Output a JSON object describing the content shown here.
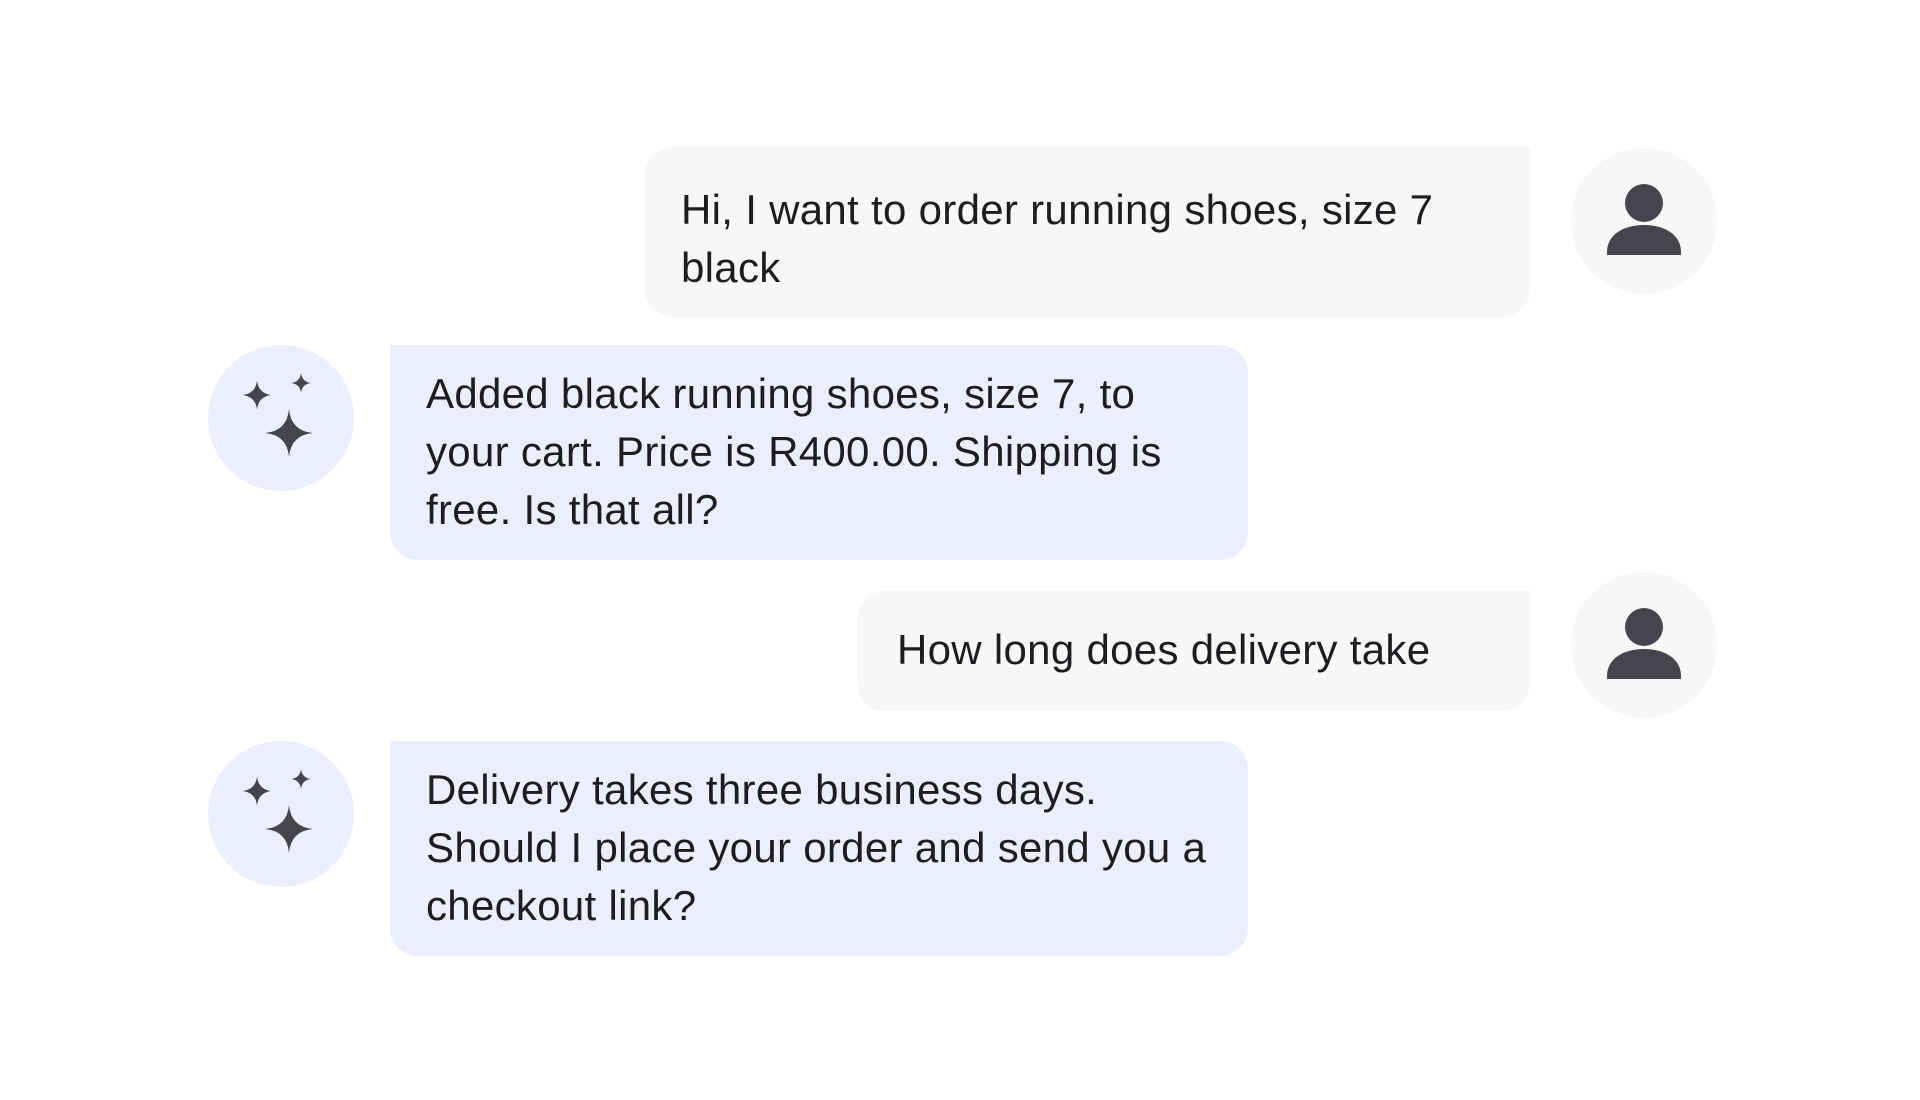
{
  "messages": [
    {
      "role": "user",
      "text": "Hi, I want to order running shoes, size 7 black",
      "avatar_icon": "person-icon"
    },
    {
      "role": "assistant",
      "text": "Added black running shoes, size 7, to your cart. Price is R400.00. Shipping is free. Is that all?",
      "avatar_icon": "sparkles-icon"
    },
    {
      "role": "user",
      "text": "How long does delivery take",
      "avatar_icon": "person-icon"
    },
    {
      "role": "assistant",
      "text": "Delivery takes three business days. Should I place your order and send you a checkout link?",
      "avatar_icon": "sparkles-icon"
    }
  ],
  "colors": {
    "user_bubble": "#f7f7f7",
    "assistant_bubble": "#eceefd",
    "icon": "#45454d",
    "text": "#1c1c21"
  }
}
